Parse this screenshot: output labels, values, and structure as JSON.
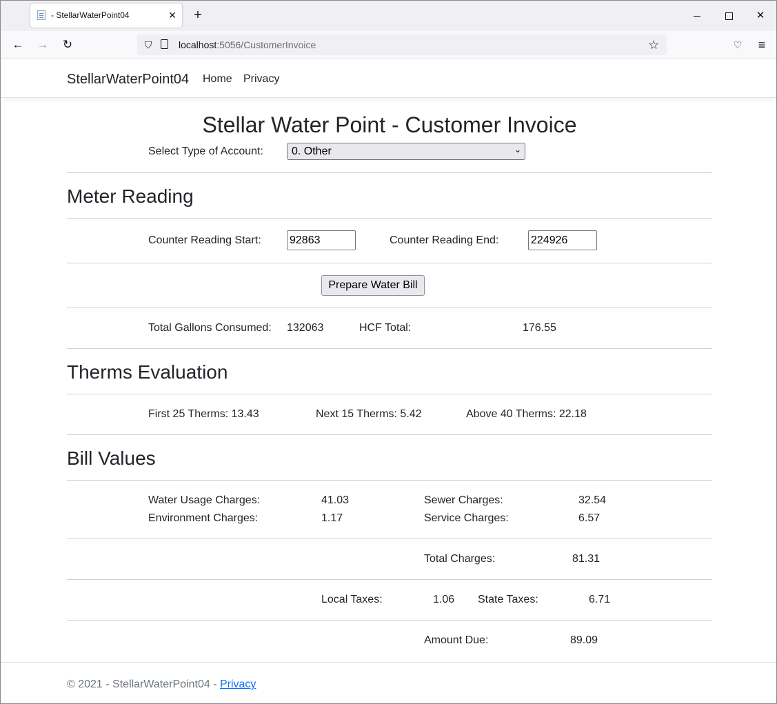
{
  "browser": {
    "tab_title": "- StellarWaterPoint04",
    "url_host": "localhost",
    "url_rest": ":5056/CustomerInvoice"
  },
  "site": {
    "brand": "StellarWaterPoint04",
    "nav": [
      "Home",
      "Privacy"
    ]
  },
  "invoice": {
    "title": "Stellar Water Point - Customer Invoice",
    "account_type_label": "Select Type of Account:",
    "account_type_value": "0. Other",
    "meter_heading": "Meter Reading",
    "counter_start_label": "Counter Reading Start:",
    "counter_start_value": "92863",
    "counter_end_label": "Counter Reading End:",
    "counter_end_value": "224926",
    "prepare_button": "Prepare Water Bill",
    "gallons_label": "Total Gallons Consumed:",
    "gallons_value": "132063",
    "hcf_label": "HCF Total:",
    "hcf_value": "176.55",
    "therms_heading": "Therms Evaluation",
    "first_therms": "First 25 Therms: 13.43",
    "next_therms": "Next 15 Therms: 5.42",
    "above_therms": "Above 40 Therms: 22.18",
    "bill_heading": "Bill Values",
    "water_usage_label": "Water Usage Charges:",
    "water_usage_value": "41.03",
    "sewer_label": "Sewer Charges:",
    "sewer_value": "32.54",
    "environment_label": "Environment Charges:",
    "environment_value": "1.17",
    "service_label": "Service Charges:",
    "service_value": "6.57",
    "total_charges_label": "Total Charges:",
    "total_charges_value": "81.31",
    "local_taxes_label": "Local Taxes:",
    "local_taxes_value": "1.06",
    "state_taxes_label": "State Taxes:",
    "state_taxes_value": "6.71",
    "amount_due_label": "Amount Due:",
    "amount_due_value": "89.09"
  },
  "footer": {
    "text": "© 2021 - StellarWaterPoint04 -",
    "link": "Privacy"
  }
}
